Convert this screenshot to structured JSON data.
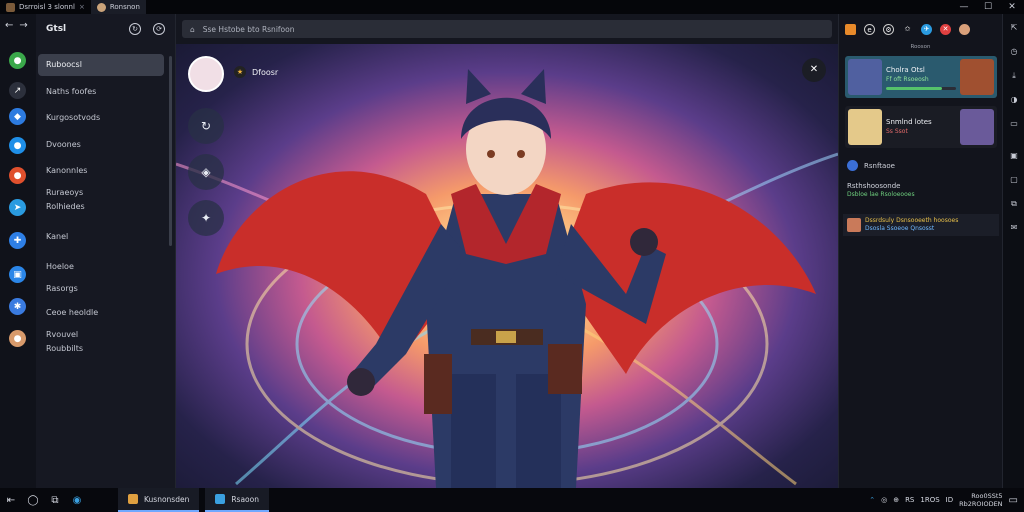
{
  "tabs": [
    {
      "label": "Dsrroisl 3 slonnl",
      "close": "×",
      "active": false
    },
    {
      "label": "Ronsnon",
      "close": "",
      "active": true
    }
  ],
  "window_controls": {
    "minimize": "—",
    "maximize": "☐",
    "close": "✕"
  },
  "rail": {
    "back": "←",
    "forward": "→",
    "icons": [
      {
        "name": "green-app-icon",
        "color": "#3aa84a",
        "glyph": "●"
      },
      {
        "name": "share-icon",
        "color": "#2c303c",
        "glyph": "↗"
      },
      {
        "name": "blue-bird-icon",
        "color": "#2d7be0",
        "glyph": "◆"
      },
      {
        "name": "blue-app-icon",
        "color": "#1f8fe8",
        "glyph": "●"
      },
      {
        "name": "red-app-icon",
        "color": "#e0502d",
        "glyph": "●"
      },
      {
        "name": "telegram-icon",
        "color": "#2a9be0",
        "glyph": "➤"
      },
      {
        "name": "puzzle-icon",
        "color": "#2e7fe6",
        "glyph": "✚"
      },
      {
        "name": "window-icon",
        "color": "#2b86e8",
        "glyph": "▣"
      },
      {
        "name": "gear-blue-icon",
        "color": "#3a7be0",
        "glyph": "✱"
      },
      {
        "name": "user-avatar-icon",
        "color": "#d89a6b",
        "glyph": "●"
      }
    ]
  },
  "panel": {
    "title": "Gtsl",
    "items": [
      {
        "label": "Ruboocsl",
        "active": true
      },
      {
        "label": "Naths foofes",
        "active": false
      },
      {
        "label": "Kurgosotvods",
        "active": false
      },
      {
        "label": "Dvoones",
        "active": false
      },
      {
        "label": "Kanonnles",
        "active": false
      },
      {
        "label": "Ruraeoys\nRolhiedes",
        "active": false
      },
      {
        "label": "Kanel",
        "active": false
      },
      {
        "label": "Hoeloe",
        "active": false
      },
      {
        "label": "Rasorgs",
        "active": false
      },
      {
        "label": "Ceoe heoldle",
        "active": false
      },
      {
        "label": "Rvouvel\nRoubbilts",
        "active": false
      }
    ]
  },
  "address": {
    "text": "Sse Hstobe bto Rsnifoon"
  },
  "stage": {
    "user": "Dfoosr",
    "side_buttons": [
      {
        "name": "repost-icon",
        "glyph": "↻"
      },
      {
        "name": "shield-icon",
        "glyph": "◈"
      },
      {
        "name": "gift-icon",
        "glyph": "✦"
      }
    ],
    "share_glyph": "✕"
  },
  "right_panel": {
    "top_label": "Rooson",
    "cards": [
      {
        "title": "Cholra Otsl",
        "sub": "Ff oft Rsoeosh",
        "progress": 0.8,
        "bg": "#2a5a6e"
      },
      {
        "title": "Snmlnd lotes",
        "sub": "Ss Ssot",
        "progress": 0.0,
        "bg": "#1a1c24"
      }
    ],
    "row1": "Rsnftaoe",
    "row2": "Rsthshoosonde",
    "row2_sub": "Dsbloe lae Rsoloeooes",
    "notif_line1": "Dssrdsuly Dsnsooeeth hoosoes",
    "notif_line2": "Dsosla Ssoeoe Qnsosst"
  },
  "taskbar": {
    "apps": [
      {
        "label": "Kusnonsden",
        "color": "#e0a040"
      },
      {
        "label": "Rsaoon",
        "color": "#3aa0e0"
      }
    ],
    "tray": [
      "⌃",
      "◎",
      "⊕",
      "RS",
      "1ROS",
      "ID"
    ],
    "clock_line1": "Roo0SSt5",
    "clock_line2": "Rb2ROIODEN"
  },
  "colors": {
    "accent": "#6fa8ff",
    "active_item": "#3b3f4c"
  }
}
